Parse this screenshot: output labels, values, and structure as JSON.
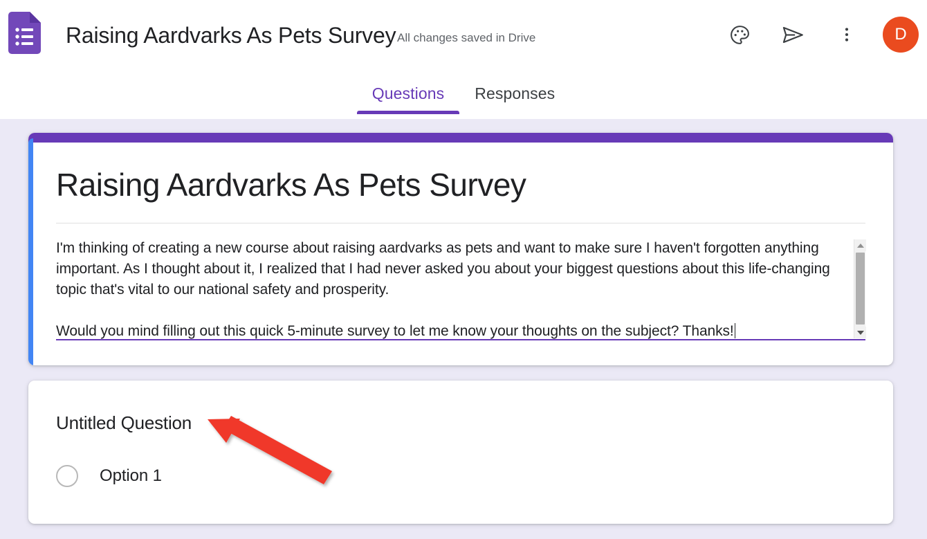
{
  "app": {
    "product_icon": "google-forms-icon",
    "theme_purple": "#673ab7",
    "accent_blue": "#4285f4",
    "avatar_color": "#ea4b1f",
    "annotation_color": "#f0392b",
    "background": "#ebe9f6"
  },
  "header": {
    "doc_title": "Raising Aardvarks As Pets Survey",
    "save_status": "All changes saved in Drive",
    "actions": [
      {
        "name": "palette-icon",
        "label": "Customize theme"
      },
      {
        "name": "send-icon",
        "label": "Send"
      },
      {
        "name": "more-vert-icon",
        "label": "More options"
      }
    ],
    "avatar_initial": "D"
  },
  "tabs": [
    {
      "label": "Questions",
      "active": true
    },
    {
      "label": "Responses",
      "active": false
    }
  ],
  "form": {
    "title": "Raising Aardvarks As Pets Survey",
    "description_paragraph_1": "I'm thinking of creating a new course about raising aardvarks as pets and want to make sure I haven't forgotten anything important. As I thought about it, I realized that I had never asked you about your biggest questions about this life-changing topic that's vital to our national safety and prosperity.",
    "description_paragraph_2": "Would you mind filling out this quick 5-minute survey to let me know your thoughts on the subject? Thanks!"
  },
  "question": {
    "title": "Untitled Question",
    "options": [
      {
        "label": "Option 1",
        "selected": false
      }
    ]
  }
}
